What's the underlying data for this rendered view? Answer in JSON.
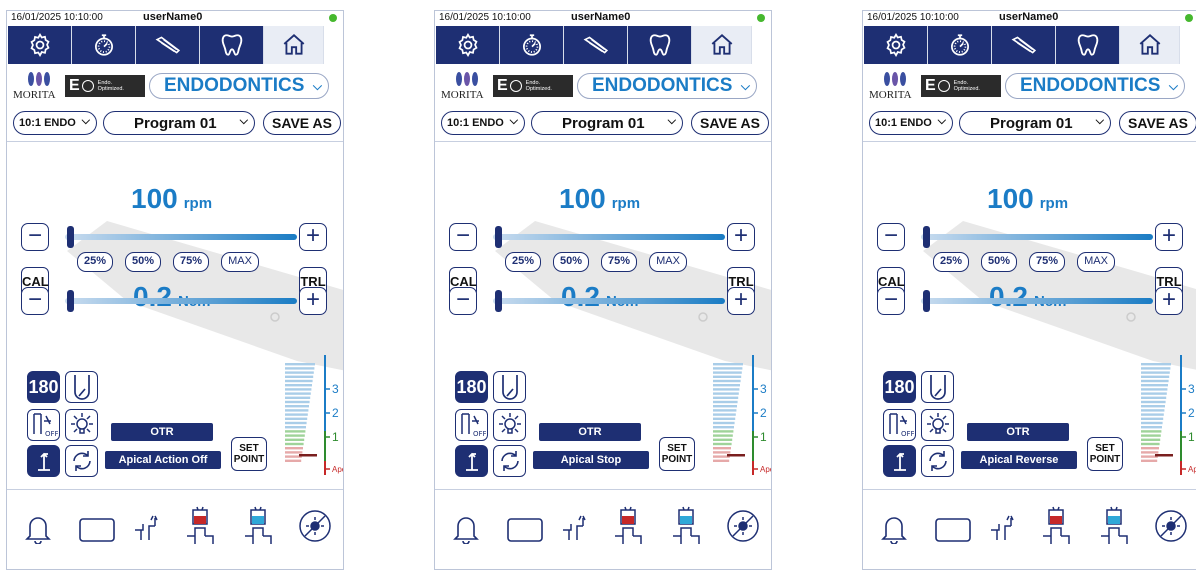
{
  "panels": [
    {
      "datetime": "16/01/2025 10:10:00",
      "user": "userName0",
      "mode": "ENDODONTICS",
      "ratio": "10:1 ENDO",
      "program": "Program 01",
      "save_label": "SAVE AS",
      "speed_value": "100",
      "speed_unit": "rpm",
      "torque_value": "0.2",
      "torque_unit": "Ncm",
      "pct": [
        "25%",
        "50%",
        "75%",
        "MAX"
      ],
      "cal": "CAL",
      "trl": "TRL",
      "angle": "180",
      "otr": "OTR",
      "apical": "Apical Action Off",
      "setpoint": "SET POINT",
      "scale": [
        "3",
        "2",
        "1",
        "Apex"
      ]
    },
    {
      "datetime": "16/01/2025 10:10:00",
      "user": "userName0",
      "mode": "ENDODONTICS",
      "ratio": "10:1 ENDO",
      "program": "Program 01",
      "save_label": "SAVE AS",
      "speed_value": "100",
      "speed_unit": "rpm",
      "torque_value": "0.2",
      "torque_unit": "Ncm",
      "pct": [
        "25%",
        "50%",
        "75%",
        "MAX"
      ],
      "cal": "CAL",
      "trl": "TRL",
      "angle": "180",
      "otr": "OTR",
      "apical": "Apical Stop",
      "setpoint": "SET POINT",
      "scale": [
        "3",
        "2",
        "1",
        "Apex"
      ]
    },
    {
      "datetime": "16/01/2025 10:10:00",
      "user": "userName0",
      "mode": "ENDODONTICS",
      "ratio": "10:1 ENDO",
      "program": "Program 01",
      "save_label": "SAVE AS",
      "speed_value": "100",
      "speed_unit": "rpm",
      "torque_value": "0.2",
      "torque_unit": "Ncm",
      "pct": [
        "25%",
        "50%",
        "75%",
        "MAX"
      ],
      "cal": "CAL",
      "trl": "TRL",
      "angle": "180",
      "otr": "OTR",
      "apical": "Apical Reverse",
      "setpoint": "SET POINT",
      "scale": [
        "3",
        "2",
        "1",
        "Apex"
      ]
    }
  ],
  "brand": {
    "morita": "MORITA",
    "eo_big": "E",
    "eo_small_1": "Endo.",
    "eo_small_2": "Optimized."
  },
  "icons": {
    "nav": [
      "gear-icon",
      "timer-icon",
      "file-icon",
      "tooth-icon",
      "home-icon"
    ],
    "bottom": [
      "bell-icon",
      "rectangle-icon",
      "pump-icon",
      "irrigation-red-icon",
      "irrigation-blue-icon",
      "light-off-icon"
    ],
    "colors": {
      "navy": "#1e2f73",
      "accent": "#1b7cc6",
      "led": "#46b82e",
      "red": "#c62828",
      "green": "#2e8b2e"
    }
  }
}
